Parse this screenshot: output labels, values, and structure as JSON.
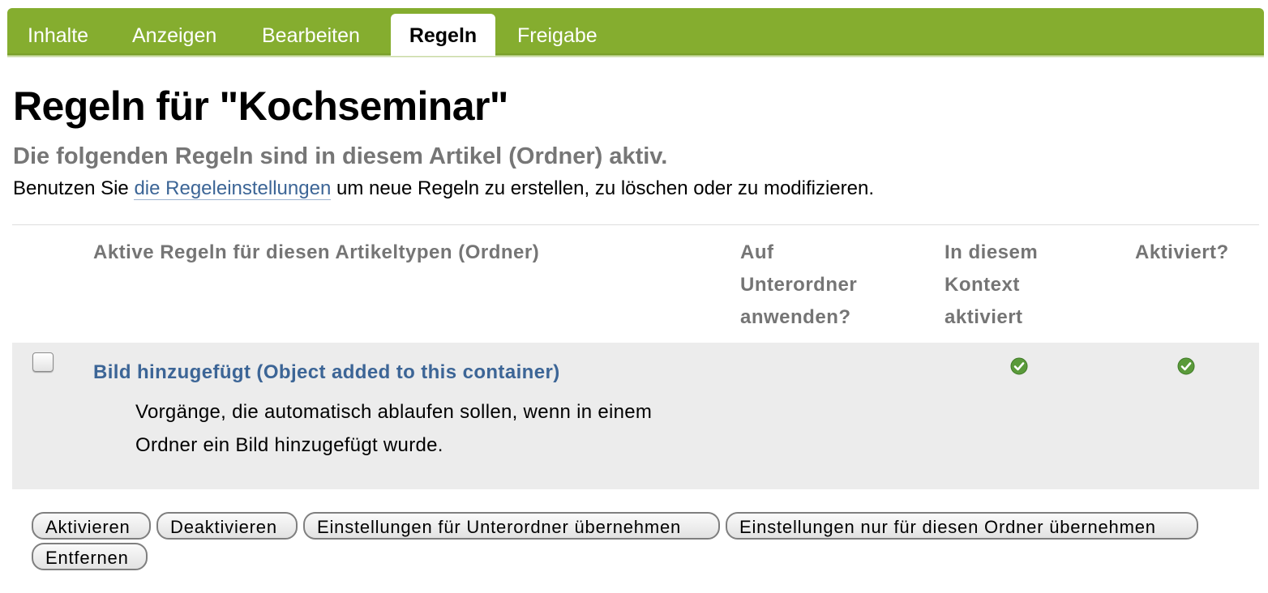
{
  "tabs": [
    {
      "label": "Inhalte"
    },
    {
      "label": "Anzeigen"
    },
    {
      "label": "Bearbeiten"
    },
    {
      "label": "Regeln",
      "active": true
    },
    {
      "label": "Freigabe"
    }
  ],
  "page": {
    "title": "Regeln für \"Kochseminar\"",
    "subtitle": "Die folgenden Regeln sind in diesem Artikel (Ordner) aktiv.",
    "help_prefix": "Benutzen Sie ",
    "help_link": "die Regeleinstellungen",
    "help_suffix": " um neue Regeln zu erstellen, zu löschen oder zu modifizieren."
  },
  "table": {
    "headers": {
      "rule": "Aktive Regeln für diesen Artikeltypen (Ordner)",
      "subfolders": [
        "Auf",
        "Unterordner",
        "anwenden?"
      ],
      "context": [
        "In diesem",
        "Kontext",
        "aktiviert"
      ],
      "enabled": "Aktiviert?"
    },
    "rows": [
      {
        "title": "Bild hinzugefügt (Object added to this container)",
        "description": "Vorgänge, die automatisch ablaufen sollen, wenn in einem Ordner ein Bild hinzugefügt wurde.",
        "checked": false,
        "apply_subfolders": false,
        "context_enabled": true,
        "enabled": true
      }
    ]
  },
  "buttons": {
    "activate": "Aktivieren",
    "deactivate": "Deaktivieren",
    "apply_subfolders": "Einstellungen für Unterordner übernehmen",
    "apply_folder_only": "Einstellungen nur für diesen Ordner übernehmen",
    "remove": "Entfernen"
  },
  "colors": {
    "tab_bar": "#85ad2f",
    "link": "#3c6596",
    "check_icon": "#5a9a3a",
    "row_background": "#ececec"
  },
  "icons": {
    "status_enabled": "check-circle-icon"
  }
}
